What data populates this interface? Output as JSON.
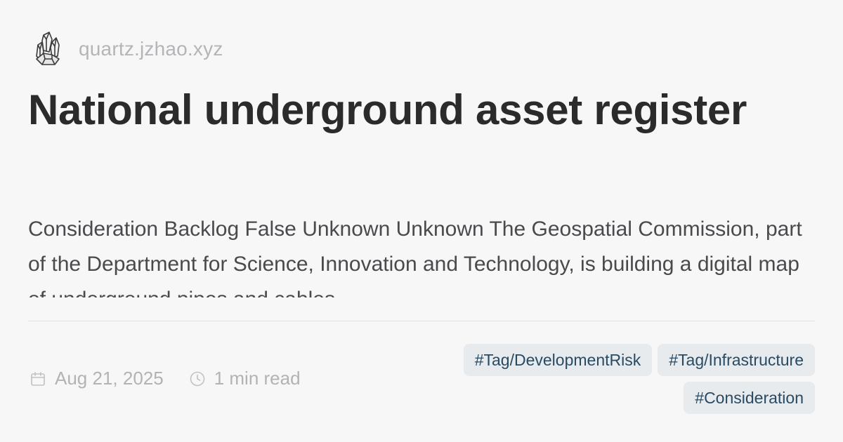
{
  "site": {
    "name": "quartz.jzhao.xyz",
    "logo_icon": "crystal-cluster-icon"
  },
  "page": {
    "title": "National underground asset register",
    "description": "Consideration Backlog False Unknown Unknown The Geospatial Commission, part of the Department for Science, Innovation and Technology, is building a digital map of underground pipes and cables"
  },
  "meta": {
    "date_icon": "calendar-icon",
    "date": "Aug 21, 2025",
    "reading_time_icon": "clock-icon",
    "reading_time": "1 min read"
  },
  "tags": [
    "#Tag/DevelopmentRisk",
    "#Tag/Infrastructure",
    "#Consideration"
  ],
  "colors": {
    "background": "#f7f7f8",
    "title": "#2b2b2b",
    "muted": "#b3b3b6",
    "tag_background": "#e8ebee",
    "tag_text": "#284b63"
  }
}
